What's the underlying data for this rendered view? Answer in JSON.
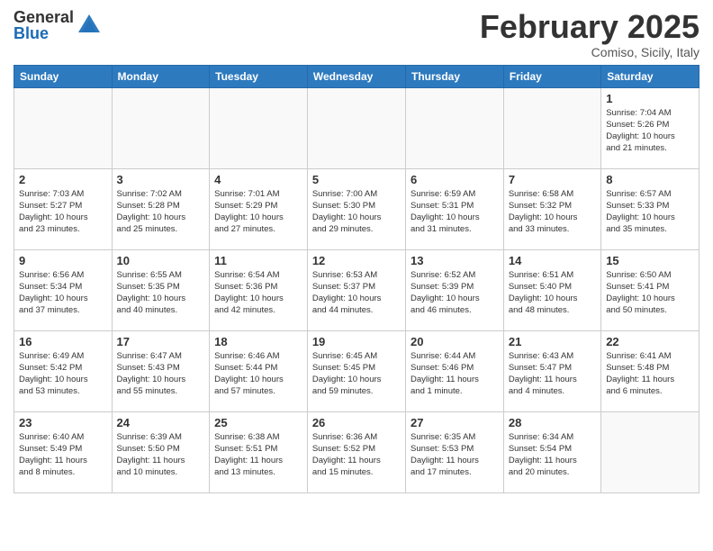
{
  "logo": {
    "general": "General",
    "blue": "Blue"
  },
  "header": {
    "title": "February 2025",
    "subtitle": "Comiso, Sicily, Italy"
  },
  "weekdays": [
    "Sunday",
    "Monday",
    "Tuesday",
    "Wednesday",
    "Thursday",
    "Friday",
    "Saturday"
  ],
  "weeks": [
    [
      {
        "day": "",
        "info": ""
      },
      {
        "day": "",
        "info": ""
      },
      {
        "day": "",
        "info": ""
      },
      {
        "day": "",
        "info": ""
      },
      {
        "day": "",
        "info": ""
      },
      {
        "day": "",
        "info": ""
      },
      {
        "day": "1",
        "info": "Sunrise: 7:04 AM\nSunset: 5:26 PM\nDaylight: 10 hours\nand 21 minutes."
      }
    ],
    [
      {
        "day": "2",
        "info": "Sunrise: 7:03 AM\nSunset: 5:27 PM\nDaylight: 10 hours\nand 23 minutes."
      },
      {
        "day": "3",
        "info": "Sunrise: 7:02 AM\nSunset: 5:28 PM\nDaylight: 10 hours\nand 25 minutes."
      },
      {
        "day": "4",
        "info": "Sunrise: 7:01 AM\nSunset: 5:29 PM\nDaylight: 10 hours\nand 27 minutes."
      },
      {
        "day": "5",
        "info": "Sunrise: 7:00 AM\nSunset: 5:30 PM\nDaylight: 10 hours\nand 29 minutes."
      },
      {
        "day": "6",
        "info": "Sunrise: 6:59 AM\nSunset: 5:31 PM\nDaylight: 10 hours\nand 31 minutes."
      },
      {
        "day": "7",
        "info": "Sunrise: 6:58 AM\nSunset: 5:32 PM\nDaylight: 10 hours\nand 33 minutes."
      },
      {
        "day": "8",
        "info": "Sunrise: 6:57 AM\nSunset: 5:33 PM\nDaylight: 10 hours\nand 35 minutes."
      }
    ],
    [
      {
        "day": "9",
        "info": "Sunrise: 6:56 AM\nSunset: 5:34 PM\nDaylight: 10 hours\nand 37 minutes."
      },
      {
        "day": "10",
        "info": "Sunrise: 6:55 AM\nSunset: 5:35 PM\nDaylight: 10 hours\nand 40 minutes."
      },
      {
        "day": "11",
        "info": "Sunrise: 6:54 AM\nSunset: 5:36 PM\nDaylight: 10 hours\nand 42 minutes."
      },
      {
        "day": "12",
        "info": "Sunrise: 6:53 AM\nSunset: 5:37 PM\nDaylight: 10 hours\nand 44 minutes."
      },
      {
        "day": "13",
        "info": "Sunrise: 6:52 AM\nSunset: 5:39 PM\nDaylight: 10 hours\nand 46 minutes."
      },
      {
        "day": "14",
        "info": "Sunrise: 6:51 AM\nSunset: 5:40 PM\nDaylight: 10 hours\nand 48 minutes."
      },
      {
        "day": "15",
        "info": "Sunrise: 6:50 AM\nSunset: 5:41 PM\nDaylight: 10 hours\nand 50 minutes."
      }
    ],
    [
      {
        "day": "16",
        "info": "Sunrise: 6:49 AM\nSunset: 5:42 PM\nDaylight: 10 hours\nand 53 minutes."
      },
      {
        "day": "17",
        "info": "Sunrise: 6:47 AM\nSunset: 5:43 PM\nDaylight: 10 hours\nand 55 minutes."
      },
      {
        "day": "18",
        "info": "Sunrise: 6:46 AM\nSunset: 5:44 PM\nDaylight: 10 hours\nand 57 minutes."
      },
      {
        "day": "19",
        "info": "Sunrise: 6:45 AM\nSunset: 5:45 PM\nDaylight: 10 hours\nand 59 minutes."
      },
      {
        "day": "20",
        "info": "Sunrise: 6:44 AM\nSunset: 5:46 PM\nDaylight: 11 hours\nand 1 minute."
      },
      {
        "day": "21",
        "info": "Sunrise: 6:43 AM\nSunset: 5:47 PM\nDaylight: 11 hours\nand 4 minutes."
      },
      {
        "day": "22",
        "info": "Sunrise: 6:41 AM\nSunset: 5:48 PM\nDaylight: 11 hours\nand 6 minutes."
      }
    ],
    [
      {
        "day": "23",
        "info": "Sunrise: 6:40 AM\nSunset: 5:49 PM\nDaylight: 11 hours\nand 8 minutes."
      },
      {
        "day": "24",
        "info": "Sunrise: 6:39 AM\nSunset: 5:50 PM\nDaylight: 11 hours\nand 10 minutes."
      },
      {
        "day": "25",
        "info": "Sunrise: 6:38 AM\nSunset: 5:51 PM\nDaylight: 11 hours\nand 13 minutes."
      },
      {
        "day": "26",
        "info": "Sunrise: 6:36 AM\nSunset: 5:52 PM\nDaylight: 11 hours\nand 15 minutes."
      },
      {
        "day": "27",
        "info": "Sunrise: 6:35 AM\nSunset: 5:53 PM\nDaylight: 11 hours\nand 17 minutes."
      },
      {
        "day": "28",
        "info": "Sunrise: 6:34 AM\nSunset: 5:54 PM\nDaylight: 11 hours\nand 20 minutes."
      },
      {
        "day": "",
        "info": ""
      }
    ]
  ]
}
